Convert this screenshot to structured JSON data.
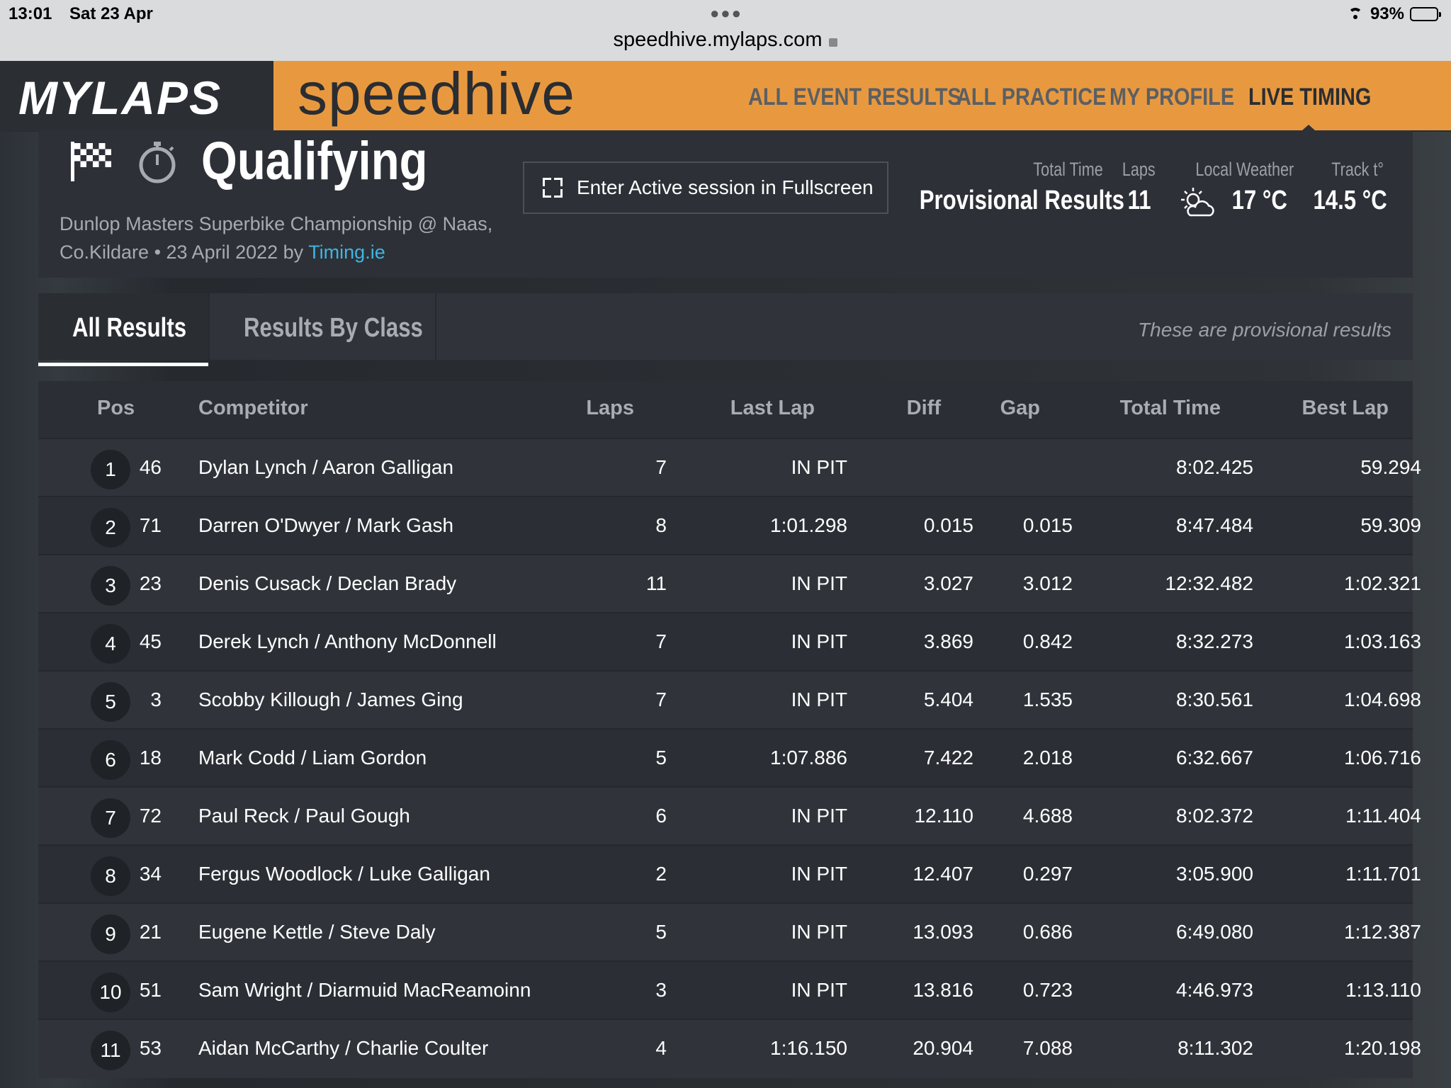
{
  "status_bar": {
    "time": "13:01",
    "date": "Sat 23 Apr",
    "url": "speedhive.mylaps.com",
    "battery": "93%",
    "battery_level": 0.93
  },
  "header": {
    "brand": "MYLAPS",
    "product": "speedhive",
    "nav": [
      "ALL EVENT RESULTS",
      "ALL PRACTICE",
      "MY PROFILE",
      "LIVE TIMING"
    ],
    "active_nav": "LIVE TIMING"
  },
  "session": {
    "title": "Qualifying",
    "event": "Dunlop Masters Superbike Championship @ Naas, Co.Kildare • 23 April 2022 by",
    "organizer": "Timing.ie",
    "fullscreen_label": "Enter Active session in Fullscreen",
    "stats": {
      "total_time_label": "Total Time",
      "total_time_value": "Provisional Results",
      "laps_label": "Laps",
      "laps_value": "11",
      "weather_label": "Local Weather",
      "weather_value": "17 °C",
      "weather_icon": "partly-cloudy-icon",
      "track_label": "Track t°",
      "track_value": "14.5 °C"
    }
  },
  "tabs": {
    "all_results": "All Results",
    "by_class": "Results By Class",
    "note": "These are provisional results"
  },
  "table": {
    "headers": {
      "pos": "Pos",
      "competitor": "Competitor",
      "laps": "Laps",
      "last_lap": "Last Lap",
      "diff": "Diff",
      "gap": "Gap",
      "total_time": "Total Time",
      "best_lap": "Best Lap"
    },
    "rows": [
      {
        "pos": "1",
        "num": "46",
        "name": "Dylan Lynch / Aaron Galligan",
        "laps": "7",
        "last": "IN PIT",
        "diff": "",
        "gap": "",
        "total": "8:02.425",
        "best": "59.294"
      },
      {
        "pos": "2",
        "num": "71",
        "name": "Darren O'Dwyer / Mark Gash",
        "laps": "8",
        "last": "1:01.298",
        "diff": "0.015",
        "gap": "0.015",
        "total": "8:47.484",
        "best": "59.309"
      },
      {
        "pos": "3",
        "num": "23",
        "name": "Denis Cusack / Declan Brady",
        "laps": "11",
        "last": "IN PIT",
        "diff": "3.027",
        "gap": "3.012",
        "total": "12:32.482",
        "best": "1:02.321"
      },
      {
        "pos": "4",
        "num": "45",
        "name": "Derek Lynch / Anthony McDonnell",
        "laps": "7",
        "last": "IN PIT",
        "diff": "3.869",
        "gap": "0.842",
        "total": "8:32.273",
        "best": "1:03.163"
      },
      {
        "pos": "5",
        "num": "3",
        "name": "Scobby Killough / James Ging",
        "laps": "7",
        "last": "IN PIT",
        "diff": "5.404",
        "gap": "1.535",
        "total": "8:30.561",
        "best": "1:04.698"
      },
      {
        "pos": "6",
        "num": "18",
        "name": "Mark Codd / Liam Gordon",
        "laps": "5",
        "last": "1:07.886",
        "diff": "7.422",
        "gap": "2.018",
        "total": "6:32.667",
        "best": "1:06.716"
      },
      {
        "pos": "7",
        "num": "72",
        "name": "Paul Reck / Paul Gough",
        "laps": "6",
        "last": "IN PIT",
        "diff": "12.110",
        "gap": "4.688",
        "total": "8:02.372",
        "best": "1:11.404"
      },
      {
        "pos": "8",
        "num": "34",
        "name": "Fergus Woodlock / Luke Galligan",
        "laps": "2",
        "last": "IN PIT",
        "diff": "12.407",
        "gap": "0.297",
        "total": "3:05.900",
        "best": "1:11.701"
      },
      {
        "pos": "9",
        "num": "21",
        "name": "Eugene Kettle / Steve Daly",
        "laps": "5",
        "last": "IN PIT",
        "diff": "13.093",
        "gap": "0.686",
        "total": "6:49.080",
        "best": "1:12.387"
      },
      {
        "pos": "10",
        "num": "51",
        "name": "Sam Wright / Diarmuid MacReamoinn",
        "laps": "3",
        "last": "IN PIT",
        "diff": "13.816",
        "gap": "0.723",
        "total": "4:46.973",
        "best": "1:13.110"
      },
      {
        "pos": "11",
        "num": "53",
        "name": "Aidan McCarthy / Charlie Coulter",
        "laps": "4",
        "last": "1:16.150",
        "diff": "20.904",
        "gap": "7.088",
        "total": "8:11.302",
        "best": "1:20.198"
      }
    ]
  },
  "colors": {
    "orange": "#e8993f",
    "link": "#3fb5e3"
  }
}
